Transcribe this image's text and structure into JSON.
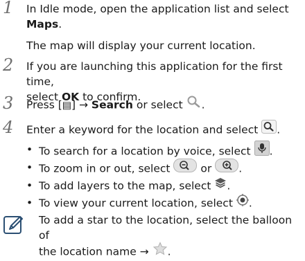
{
  "steps": [
    {
      "number": "1",
      "line1": "In Idle mode, open the application list and select",
      "bold": "Maps",
      "after_bold": ".",
      "sub": "The map will display your current location."
    },
    {
      "number": "2",
      "line1": "If you are launching this application for the first time,",
      "pre": "select ",
      "bold": "OK",
      "post": " to confirm."
    },
    {
      "number": "3",
      "pre": "Press [",
      "menu_glyph": "▤",
      "mid": "] → ",
      "bold": "Search",
      "post": " or select",
      "end": "."
    },
    {
      "number": "4",
      "text": "Enter a keyword for the location and select",
      "end": "."
    }
  ],
  "bullets": [
    {
      "text": "To search for a location by voice, select",
      "end": "."
    },
    {
      "text": "To zoom in or out, select",
      "mid": "or",
      "end": "."
    },
    {
      "text": "To add layers to the map, select",
      "end": "."
    },
    {
      "text": "To view your current location, select",
      "end": "."
    }
  ],
  "note": {
    "line1": "To add a star to the location, select the balloon of",
    "line2": "the location name →",
    "end": "."
  },
  "icons": {
    "step3": "search-icon",
    "step4": "search-button-icon",
    "voice": "microphone-icon",
    "zoom_out": "zoom-out-icon",
    "zoom_in": "zoom-in-icon",
    "layers": "layers-icon",
    "location": "my-location-icon",
    "star": "star-icon",
    "note": "note-icon"
  }
}
